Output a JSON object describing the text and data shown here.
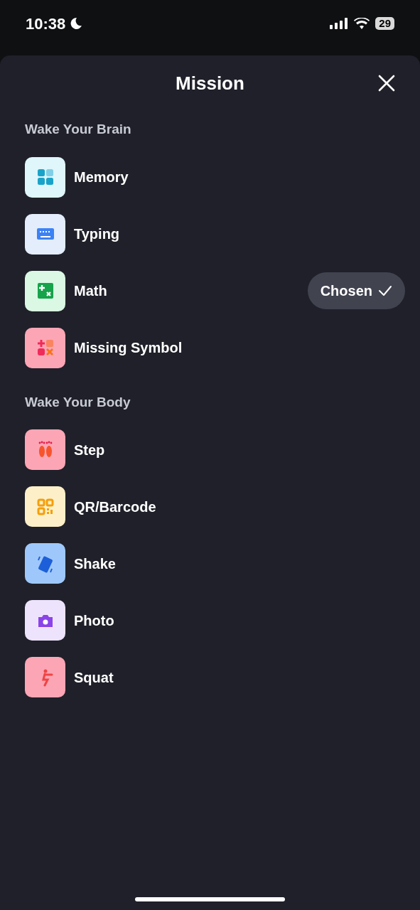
{
  "status_bar": {
    "time": "10:38",
    "battery": "29"
  },
  "sheet": {
    "title": "Mission"
  },
  "sections": [
    {
      "heading": "Wake Your Brain",
      "items": [
        {
          "label": "Memory",
          "kind": "memory",
          "selected": false
        },
        {
          "label": "Typing",
          "kind": "typing",
          "selected": false
        },
        {
          "label": "Math",
          "kind": "math",
          "selected": true,
          "badge": "Chosen"
        },
        {
          "label": "Missing Symbol",
          "kind": "symbol",
          "selected": false
        }
      ]
    },
    {
      "heading": "Wake Your Body",
      "items": [
        {
          "label": "Step",
          "kind": "step",
          "selected": false
        },
        {
          "label": "QR/Barcode",
          "kind": "qr",
          "selected": false
        },
        {
          "label": "Shake",
          "kind": "shake",
          "selected": false
        },
        {
          "label": "Photo",
          "kind": "photo",
          "selected": false
        },
        {
          "label": "Squat",
          "kind": "squat",
          "selected": false
        }
      ]
    }
  ]
}
